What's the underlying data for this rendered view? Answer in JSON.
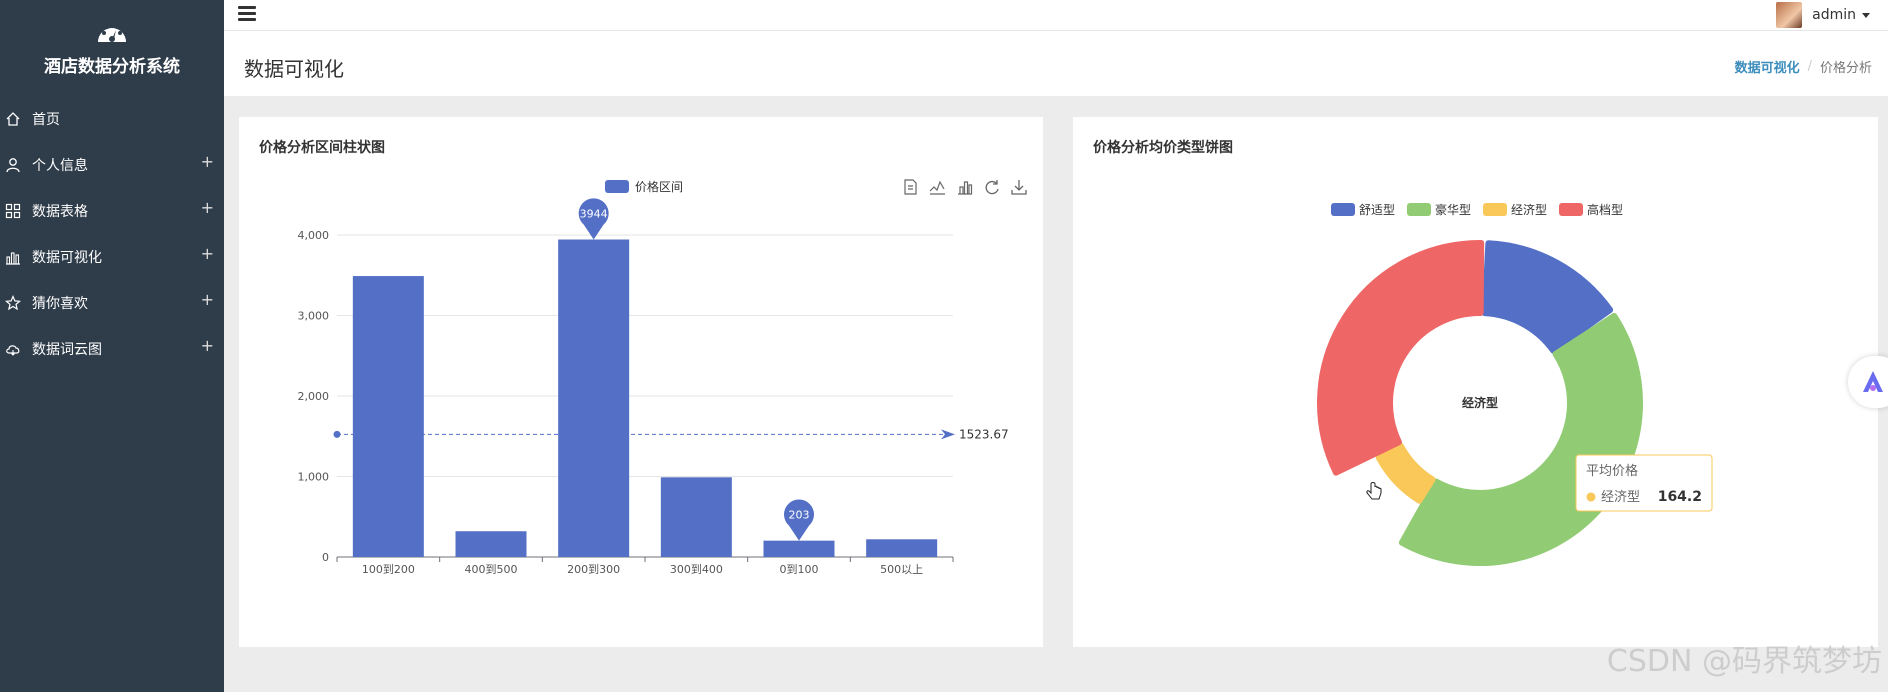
{
  "sidebar": {
    "title": "酒店数据分析系统",
    "items": [
      {
        "label": "首页",
        "icon": "home-icon",
        "expandable": false
      },
      {
        "label": "个人信息",
        "icon": "user-icon",
        "expandable": true
      },
      {
        "label": "数据表格",
        "icon": "grid-icon",
        "expandable": true
      },
      {
        "label": "数据可视化",
        "icon": "bar-chart-icon",
        "expandable": true
      },
      {
        "label": "猜你喜欢",
        "icon": "star-icon",
        "expandable": true
      },
      {
        "label": "数据词云图",
        "icon": "cloud-icon",
        "expandable": true
      }
    ],
    "plus_symbol": "+"
  },
  "topbar": {
    "user_name": "admin"
  },
  "header": {
    "page_title": "数据可视化",
    "breadcrumb": {
      "link": "数据可视化",
      "separator": "/",
      "current": "价格分析"
    }
  },
  "cards": {
    "bar_title": "价格分析区间柱状图",
    "pie_title": "价格分析均价类型饼图"
  },
  "chart_data": [
    {
      "type": "bar",
      "title": "价格分析区间柱状图",
      "legend": [
        "价格区间"
      ],
      "categories": [
        "100到200",
        "400到500",
        "200到300",
        "300到400",
        "0到100",
        "500以上"
      ],
      "series": [
        {
          "name": "价格区间",
          "values": [
            3490,
            320,
            3944,
            990,
            203,
            220
          ],
          "color": "#5470c6"
        }
      ],
      "ylim": [
        0,
        4000
      ],
      "yticks": [
        "0",
        "1,000",
        "2,000",
        "3,000",
        "4,000"
      ],
      "mark_points": [
        {
          "category": "200到300",
          "value": 3944,
          "label": "3944"
        },
        {
          "category": "0到100",
          "value": 203,
          "label": "203"
        }
      ],
      "mark_line": {
        "value": 1523.67,
        "label": "1523.67"
      },
      "grid": true,
      "toolbox": [
        "data-view-icon",
        "line-chart-icon",
        "bar-chart-icon",
        "restore-icon",
        "download-icon"
      ]
    },
    {
      "type": "pie",
      "title": "价格分析均价类型饼图",
      "legend": [
        "舒适型",
        "豪华型",
        "经济型",
        "高档型"
      ],
      "slices": [
        {
          "name": "舒适型",
          "value": 0.15,
          "color": "#5470c6"
        },
        {
          "name": "豪华型",
          "value": 0.43,
          "color": "#91cc75"
        },
        {
          "name": "经济型",
          "value": 0.09,
          "color": "#fac858"
        },
        {
          "name": "高档型",
          "value": 0.33,
          "color": "#ee6666"
        }
      ],
      "center_label": "经济型",
      "tooltip": {
        "title": "平均价格",
        "name": "经济型",
        "value": "164.2"
      }
    }
  ],
  "watermark": "CSDN @码界筑梦坊"
}
